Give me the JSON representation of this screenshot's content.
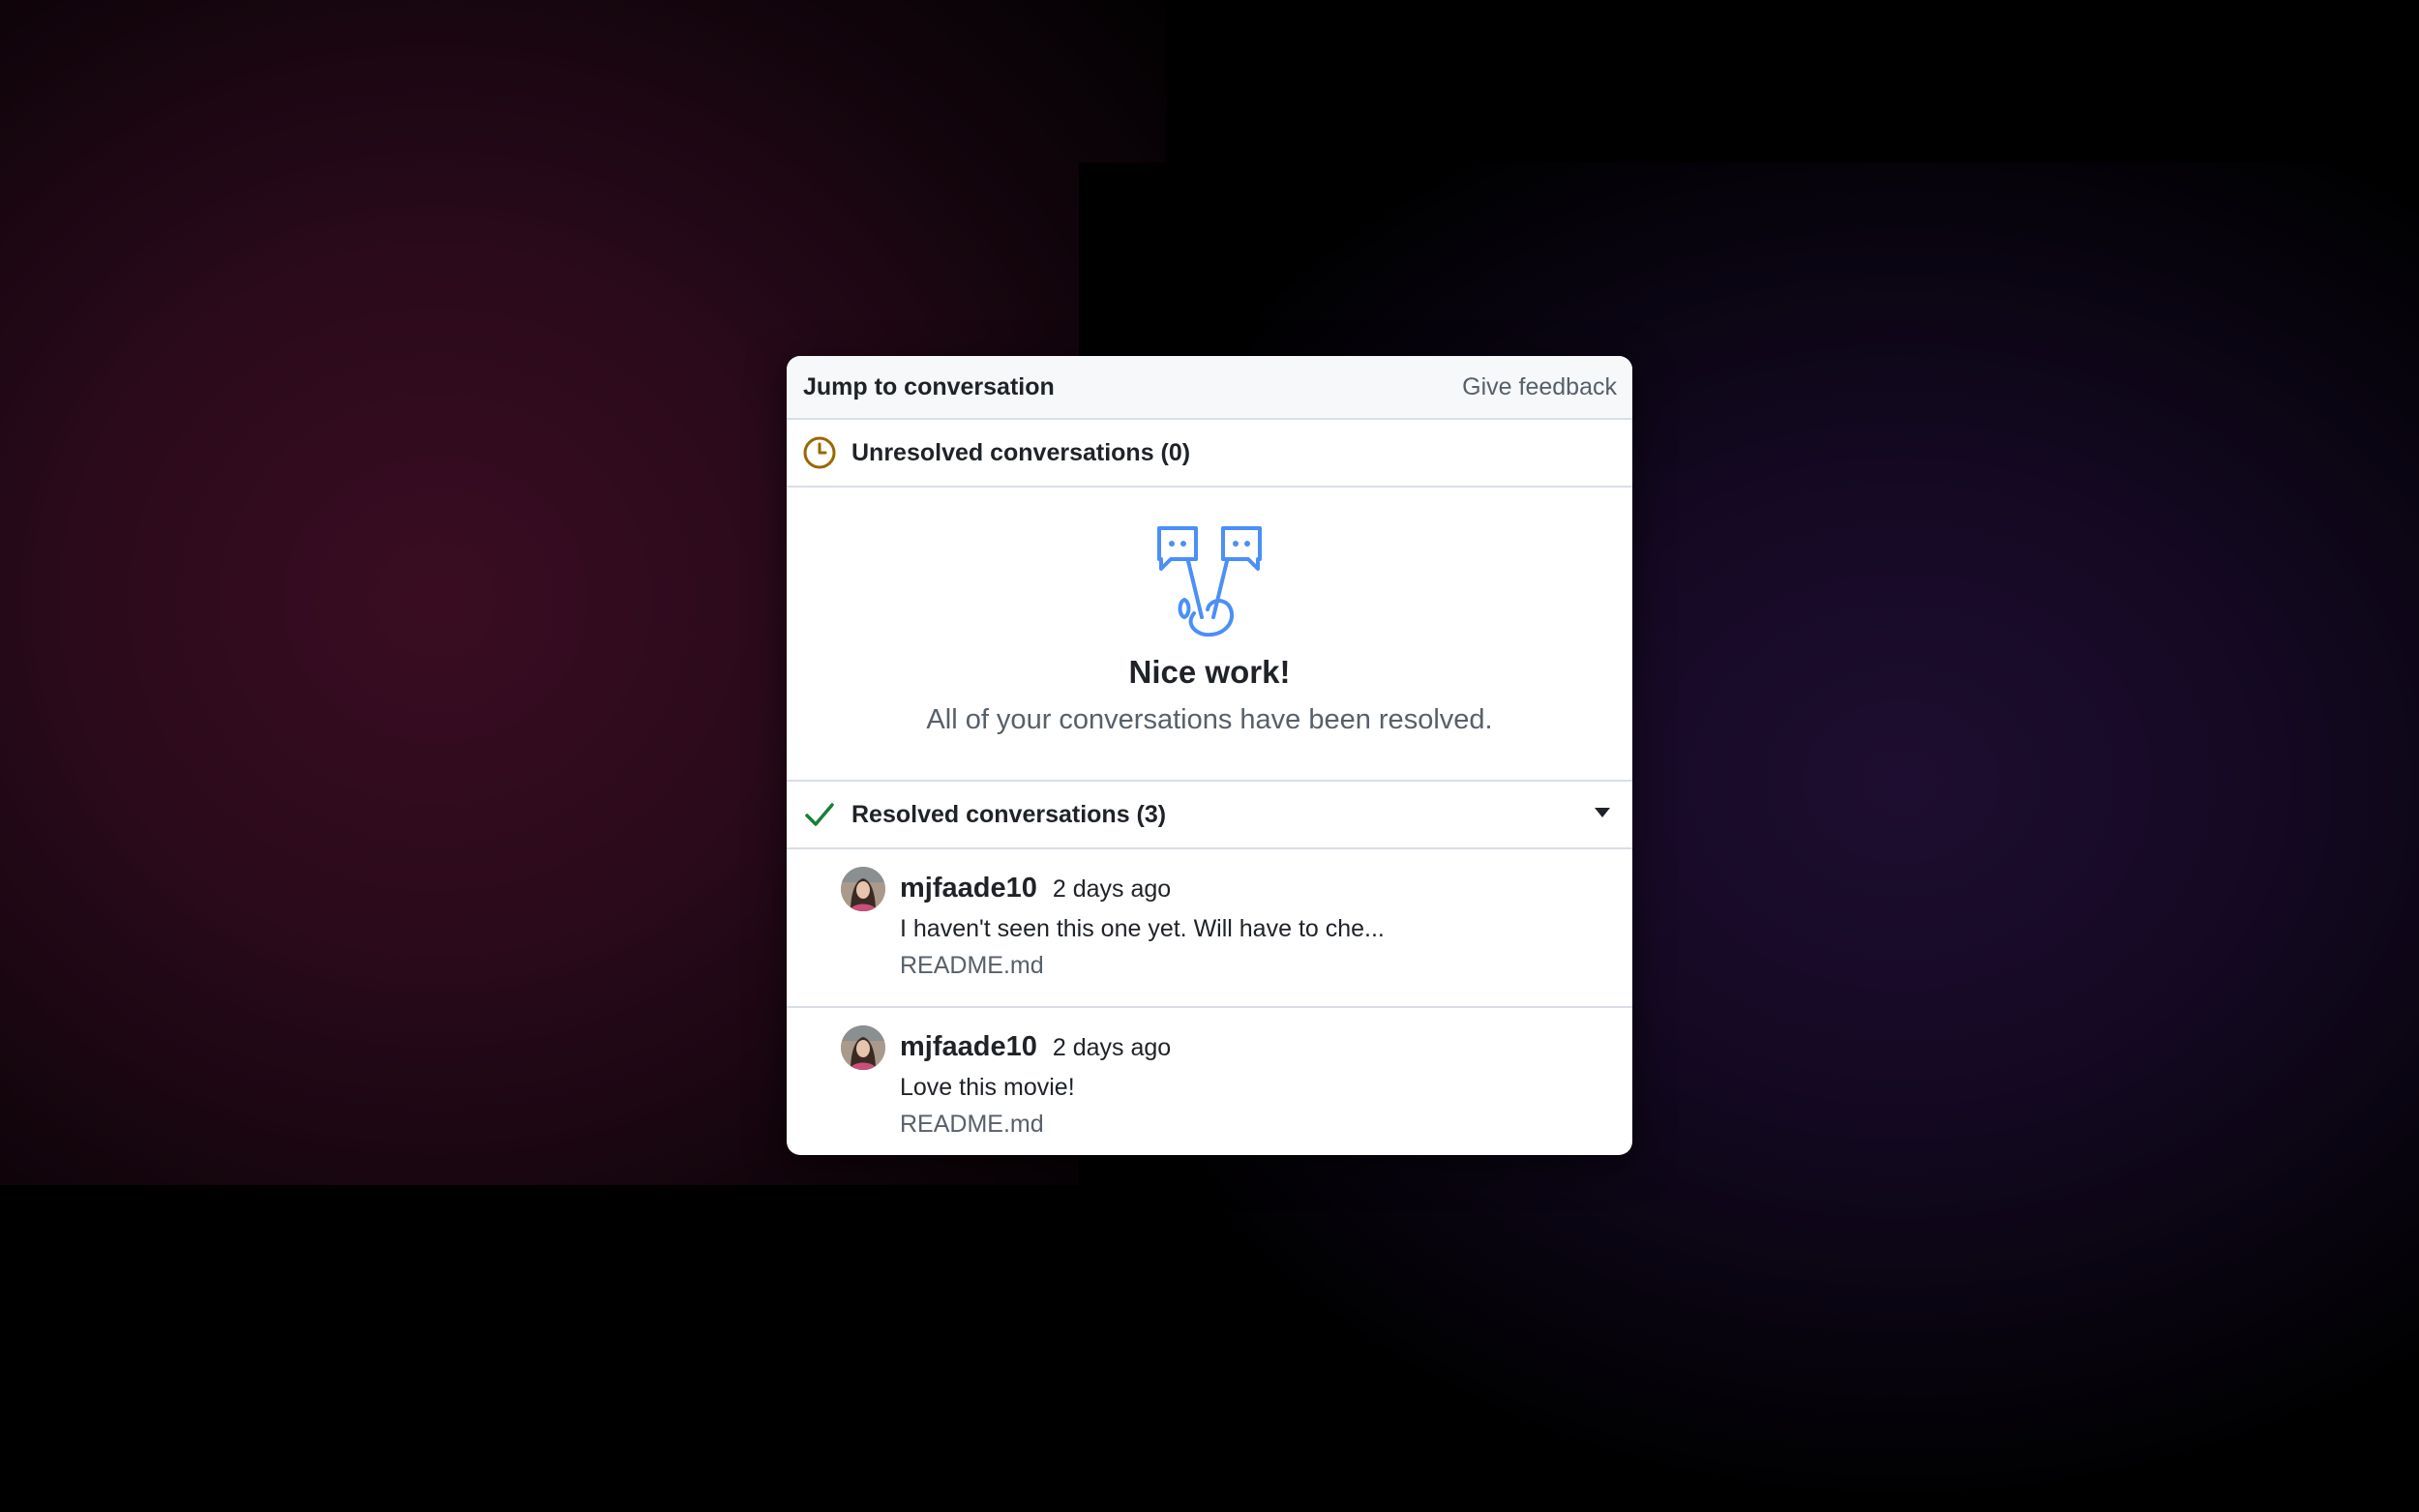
{
  "panel": {
    "title": "Jump to conversation",
    "feedback_label": "Give feedback",
    "unresolved_label": "Unresolved conversations (0)",
    "empty_title": "Nice work!",
    "empty_message": "All of your conversations have been resolved.",
    "resolved_label": "Resolved conversations (3)"
  },
  "conversations": [
    {
      "user": "mjfaade10",
      "time": "2 days ago",
      "message": "I haven't seen this one yet. Will have to che...",
      "file": "README.md"
    },
    {
      "user": "mjfaade10",
      "time": "2 days ago",
      "message": "Love this movie!",
      "file": "README.md"
    }
  ],
  "colors": {
    "unresolved_icon": "#9a6700",
    "resolved_icon": "#1a7f37",
    "illustration": "#4b8ff7"
  },
  "icons": {
    "unresolved": "clock-icon",
    "resolved": "check-icon",
    "toggle": "triangle-down-icon",
    "illustration": "peace-hand-chat-icon"
  }
}
